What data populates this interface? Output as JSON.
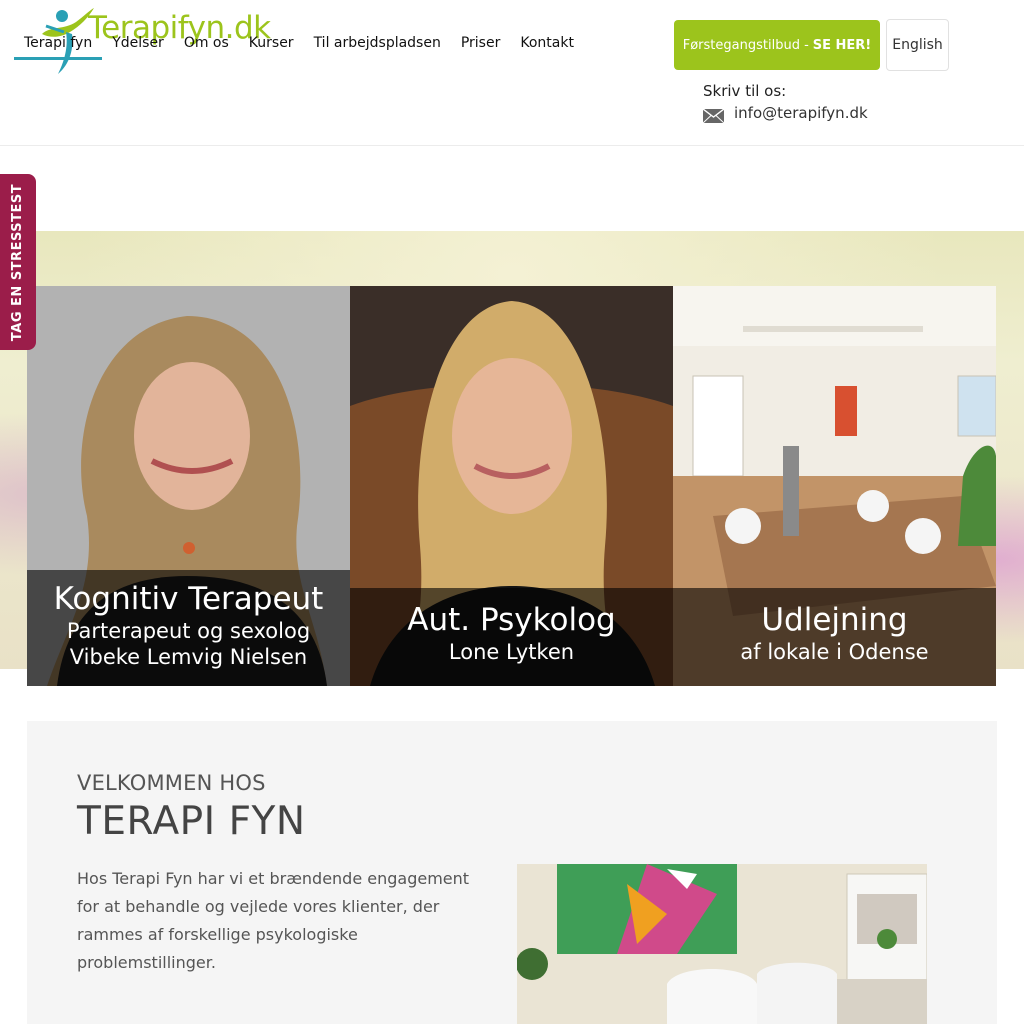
{
  "header": {
    "logo_text": "Terapifyn.dk",
    "nav": [
      "Terapi fyn",
      "Ydelser",
      "Om os",
      "Kurser",
      "Til arbejdspladsen",
      "Priser",
      "Kontakt"
    ],
    "cta_prefix": "Førstegangstilbud -",
    "cta_emphasis": "SE HER!",
    "language": "English",
    "contact_label": "Skriv til os:",
    "email": "info@terapifyn.dk",
    "icons": [
      "person-leaf-logo-icon",
      "envelope-icon"
    ]
  },
  "side_tab": {
    "label": "TAG EN STRESSTEST"
  },
  "cards": [
    {
      "title": "Kognitiv Terapeut",
      "subtitle": "Parterapeut og sexolog",
      "subtitle2": "Vibeke Lemvig Nielsen"
    },
    {
      "title": "Aut. Psykolog",
      "subtitle": "Lone Lytken"
    },
    {
      "title": "Udlejning",
      "subtitle": "af lokale i Odense"
    }
  ],
  "welcome": {
    "kicker": "VELKOMMEN HOS",
    "title": "TERAPI FYN",
    "text": "Hos Terapi Fyn har vi et brændende engagement for at behandle og vejlede vores klienter, der rammes af forskellige psykologiske problemstillinger."
  },
  "colors": {
    "brand_green": "#9cc41c",
    "active_nav_underline": "#2aa0b5",
    "side_tab": "#9b1d4a",
    "welcome_bg": "#f5f5f5"
  }
}
